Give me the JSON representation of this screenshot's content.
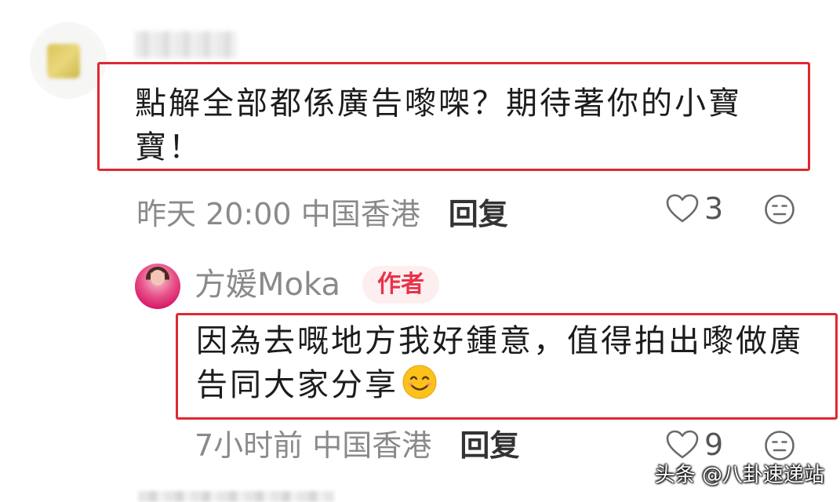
{
  "comments": [
    {
      "text": "點解全部都係廣告嚟㗎？期待著你的小寶寶！",
      "time": "昨天 20:00",
      "location": "中国香港",
      "reply_label": "回复",
      "likes": "3"
    }
  ],
  "reply": {
    "author_name": "方媛Moka",
    "badge": "作者",
    "text": "因為去嘅地方我好鍾意，值得拍出嚟做廣告同大家分享",
    "time": "7小时前",
    "location": "中国香港",
    "reply_label": "回复",
    "likes": "9"
  },
  "watermark": "头条 @八卦速递站",
  "colors": {
    "highlight_border": "#e0292f",
    "badge_text": "#e8334a",
    "badge_bg": "#fdeef0",
    "meta_text": "#8a8a8a"
  },
  "icons": [
    "heart-icon",
    "neutral-face-icon",
    "smiling-face-emoji"
  ]
}
